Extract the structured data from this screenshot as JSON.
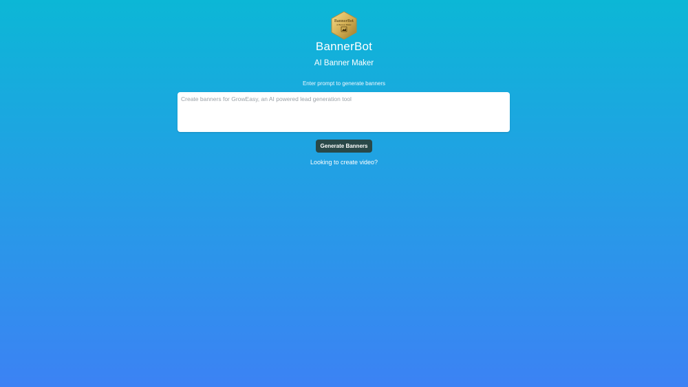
{
  "brand": {
    "logo_text": "BannerBot",
    "logo_subtext": "AI Banner Maker",
    "title": "BannerBot",
    "subtitle": "AI Banner Maker"
  },
  "prompt": {
    "label": "Enter prompt to generate banners",
    "value": "",
    "placeholder": "Create banners for GrowEasy, an AI powered lead generation tool"
  },
  "actions": {
    "generate_label": "Generate Banners",
    "video_link_label": "Looking to create video?"
  },
  "colors": {
    "gradient_top": "#0cb7d6",
    "gradient_bottom": "#3c82f4",
    "button_bg": "#294848",
    "logo_gold": "#d9b55a"
  },
  "icons": {
    "logo": "hexagon-gold-badge-icon"
  }
}
